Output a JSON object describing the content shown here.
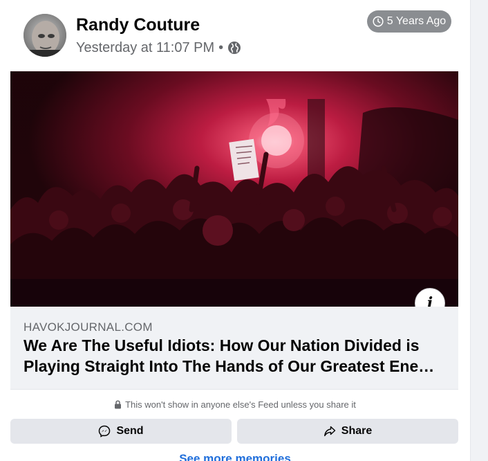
{
  "post": {
    "author_name": "Randy Couture",
    "timestamp": "Yesterday at 11:07 PM",
    "separator": "•",
    "audience_icon": "globe-icon",
    "memory_badge": "5 Years Ago",
    "memory_badge_icon": "clock-icon"
  },
  "link_preview": {
    "domain": "HAVOKJOURNAL.COM",
    "title": "We Are The Useful Idiots: How Our Nation Divided is Playing Straight Into The Hands of Our Greatest Ene…",
    "info_label": "i"
  },
  "privacy_note": {
    "icon": "lock-icon",
    "text": "This won't show in anyone else's Feed unless you share it"
  },
  "actions": {
    "send_label": "Send",
    "send_icon": "messenger-icon",
    "share_label": "Share",
    "share_icon": "share-arrow-icon"
  },
  "footer": {
    "see_more_label": "See more memories"
  },
  "colors": {
    "badge_bg": "#8a8d91",
    "muted_text": "#65676b",
    "link_blue": "#216fdb",
    "button_bg": "#e4e6eb",
    "preview_bg": "#f0f2f5"
  }
}
